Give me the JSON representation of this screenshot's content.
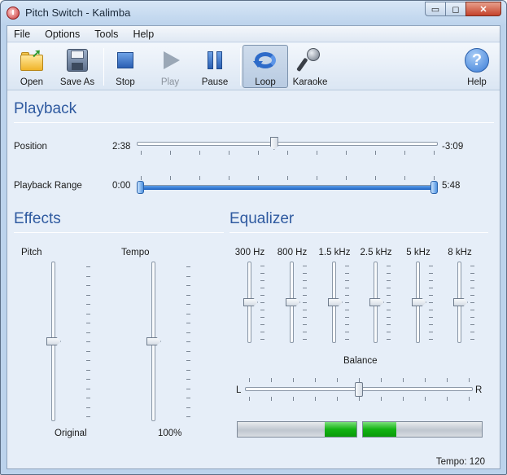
{
  "window": {
    "title": "Pitch Switch - Kalimba",
    "minimize": "▭",
    "maximize": "◻",
    "close": "✕"
  },
  "menu": [
    "File",
    "Options",
    "Tools",
    "Help"
  ],
  "toolbar": {
    "open": "Open",
    "save_as": "Save As",
    "stop": "Stop",
    "play": "Play",
    "pause": "Pause",
    "loop": "Loop",
    "karaoke": "Karaoke",
    "help": "Help",
    "help_glyph": "?"
  },
  "playback": {
    "title": "Playback",
    "position_label": "Position",
    "elapsed": "2:38",
    "remaining": "-3:09",
    "position_fraction": 0.455,
    "range_label": "Playback Range",
    "range_start": "0:00",
    "range_end": "5:48",
    "range_start_fraction": 0.0,
    "range_end_fraction": 1.0
  },
  "effects": {
    "title": "Effects",
    "pitch_label": "Pitch",
    "pitch_value": "Original",
    "pitch_fraction": 0.5,
    "tempo_label": "Tempo",
    "tempo_value": "100%",
    "tempo_fraction": 0.5
  },
  "equalizer": {
    "title": "Equalizer",
    "bands": [
      {
        "label": "300 Hz",
        "fraction": 0.5
      },
      {
        "label": "800 Hz",
        "fraction": 0.5
      },
      {
        "label": "1.5 kHz",
        "fraction": 0.5
      },
      {
        "label": "2.5 kHz",
        "fraction": 0.5
      },
      {
        "label": "5 kHz",
        "fraction": 0.5
      },
      {
        "label": "8 kHz",
        "fraction": 0.5
      }
    ],
    "balance_label": "Balance",
    "balance_left": "L",
    "balance_right": "R",
    "balance_fraction": 0.5
  },
  "meters": {
    "left_fraction": 0.27,
    "right_fraction": 0.28
  },
  "status": {
    "tempo": "Tempo: 120"
  },
  "colors": {
    "accent": "#2f5aa0",
    "range": "#1d62c3",
    "meter": "#13b313"
  },
  "icons": {
    "open": "folder-open-icon",
    "save_as": "floppy-disk-icon",
    "stop": "stop-icon",
    "play": "play-icon",
    "pause": "pause-icon",
    "loop": "loop-icon",
    "karaoke": "microphone-icon",
    "help": "help-icon"
  }
}
